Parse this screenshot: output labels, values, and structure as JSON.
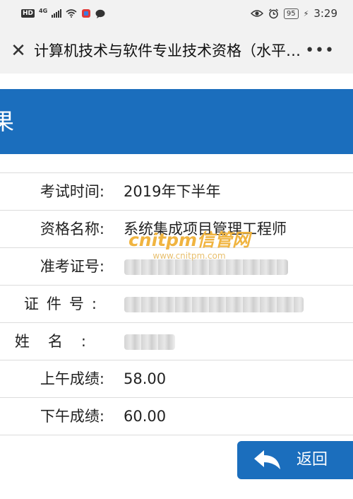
{
  "status_bar": {
    "hd": "HD",
    "network": "4G",
    "battery": "95",
    "time": "3:29"
  },
  "header": {
    "title": "计算机技术与软件专业技术资格（水平…"
  },
  "banner": {
    "text": "果"
  },
  "fields": [
    {
      "label": "考试时间:",
      "value": "2019年下半年"
    },
    {
      "label": "资格名称:",
      "value": "系统集成项目管理工程师"
    },
    {
      "label": "准考证号:",
      "value": ""
    },
    {
      "label": "证件号:",
      "value": ""
    },
    {
      "label": "姓名:",
      "value": ""
    },
    {
      "label": "上午成绩:",
      "value": "58.00"
    },
    {
      "label": "下午成绩:",
      "value": "60.00"
    }
  ],
  "watermark": {
    "main": "cnitpm信管网",
    "sub": "www.cnitpm.com"
  },
  "back_button": {
    "label": "返回"
  },
  "colors": {
    "accent": "#1b6ebd",
    "watermark": "#f0b440"
  }
}
